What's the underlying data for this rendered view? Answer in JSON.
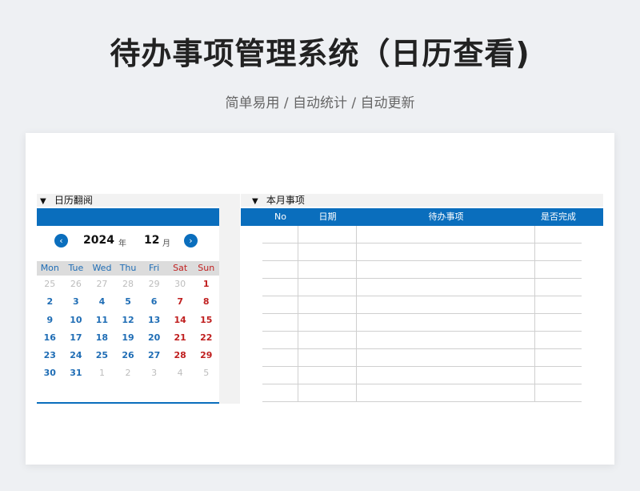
{
  "header": {
    "title": "待办事项管理系统（日历查看)",
    "subtitle": "简单易用 / 自动统计 / 自动更新"
  },
  "calendar_section": {
    "title": "日历翻阅",
    "arrow": "▼"
  },
  "tasks_section": {
    "title": "本月事项",
    "arrow": "▼"
  },
  "calendar": {
    "year": "2024",
    "year_label": "年",
    "month": "12",
    "month_label": "月",
    "prev_icon": "‹",
    "next_icon": "›",
    "weekdays": [
      "Mon",
      "Tue",
      "Wed",
      "Thu",
      "Fri",
      "Sat",
      "Sun"
    ],
    "weeks": [
      [
        {
          "d": "25",
          "out": true
        },
        {
          "d": "26",
          "out": true
        },
        {
          "d": "27",
          "out": true
        },
        {
          "d": "28",
          "out": true
        },
        {
          "d": "29",
          "out": true
        },
        {
          "d": "30",
          "out": true
        },
        {
          "d": "1",
          "out": false
        }
      ],
      [
        {
          "d": "2",
          "out": false
        },
        {
          "d": "3",
          "out": false
        },
        {
          "d": "4",
          "out": false
        },
        {
          "d": "5",
          "out": false
        },
        {
          "d": "6",
          "out": false
        },
        {
          "d": "7",
          "out": false
        },
        {
          "d": "8",
          "out": false
        }
      ],
      [
        {
          "d": "9",
          "out": false
        },
        {
          "d": "10",
          "out": false
        },
        {
          "d": "11",
          "out": false
        },
        {
          "d": "12",
          "out": false
        },
        {
          "d": "13",
          "out": false
        },
        {
          "d": "14",
          "out": false
        },
        {
          "d": "15",
          "out": false
        }
      ],
      [
        {
          "d": "16",
          "out": false
        },
        {
          "d": "17",
          "out": false
        },
        {
          "d": "18",
          "out": false
        },
        {
          "d": "19",
          "out": false
        },
        {
          "d": "20",
          "out": false
        },
        {
          "d": "21",
          "out": false
        },
        {
          "d": "22",
          "out": false
        }
      ],
      [
        {
          "d": "23",
          "out": false
        },
        {
          "d": "24",
          "out": false
        },
        {
          "d": "25",
          "out": false
        },
        {
          "d": "26",
          "out": false
        },
        {
          "d": "27",
          "out": false
        },
        {
          "d": "28",
          "out": false
        },
        {
          "d": "29",
          "out": false
        }
      ],
      [
        {
          "d": "30",
          "out": false
        },
        {
          "d": "31",
          "out": false
        },
        {
          "d": "1",
          "out": true
        },
        {
          "d": "2",
          "out": true
        },
        {
          "d": "3",
          "out": true
        },
        {
          "d": "4",
          "out": true
        },
        {
          "d": "5",
          "out": true
        }
      ]
    ]
  },
  "tasks_table": {
    "columns": [
      "No",
      "日期",
      "待办事项",
      "是否完成"
    ],
    "empty_rows": 10
  },
  "colors": {
    "accent": "#0a6ebd",
    "weekday_text": "#1f6db5",
    "weekend_text": "#c01f1f",
    "out_of_month_text": "#bdbdbd"
  }
}
